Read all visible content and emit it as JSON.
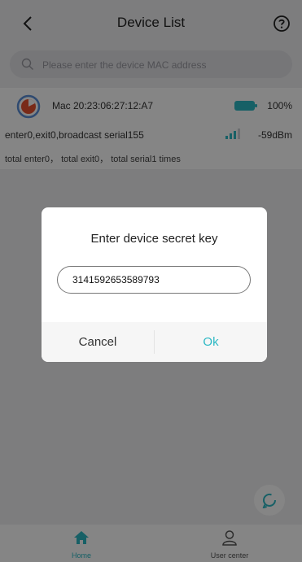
{
  "header": {
    "title": "Device List",
    "back_icon": "chevron-left-icon",
    "help_icon": "question-circle-icon"
  },
  "search": {
    "placeholder": "Please enter the device MAC address",
    "icon": "search-icon"
  },
  "device": {
    "mac": "Mac 20:23:06:27:12:A7",
    "battery": "100%",
    "battery_level": 1.0,
    "status": "enter0,exit0,broadcast serial155",
    "rssi": "-59dBm",
    "totals": "total enter0， total exit0， total serial1 times"
  },
  "dialog": {
    "title": "Enter device secret key",
    "value": "3141592653589793",
    "cancel_label": "Cancel",
    "ok_label": "Ok"
  },
  "nav": {
    "items": [
      {
        "label": "Home",
        "icon": "home-icon",
        "active": true
      },
      {
        "label": "User center",
        "icon": "user-icon",
        "active": false
      }
    ]
  },
  "colors": {
    "accent": "#2cb8c4",
    "battery": "#2cb8c4",
    "device_icon": "#e8512f",
    "overlay": "#000000"
  }
}
